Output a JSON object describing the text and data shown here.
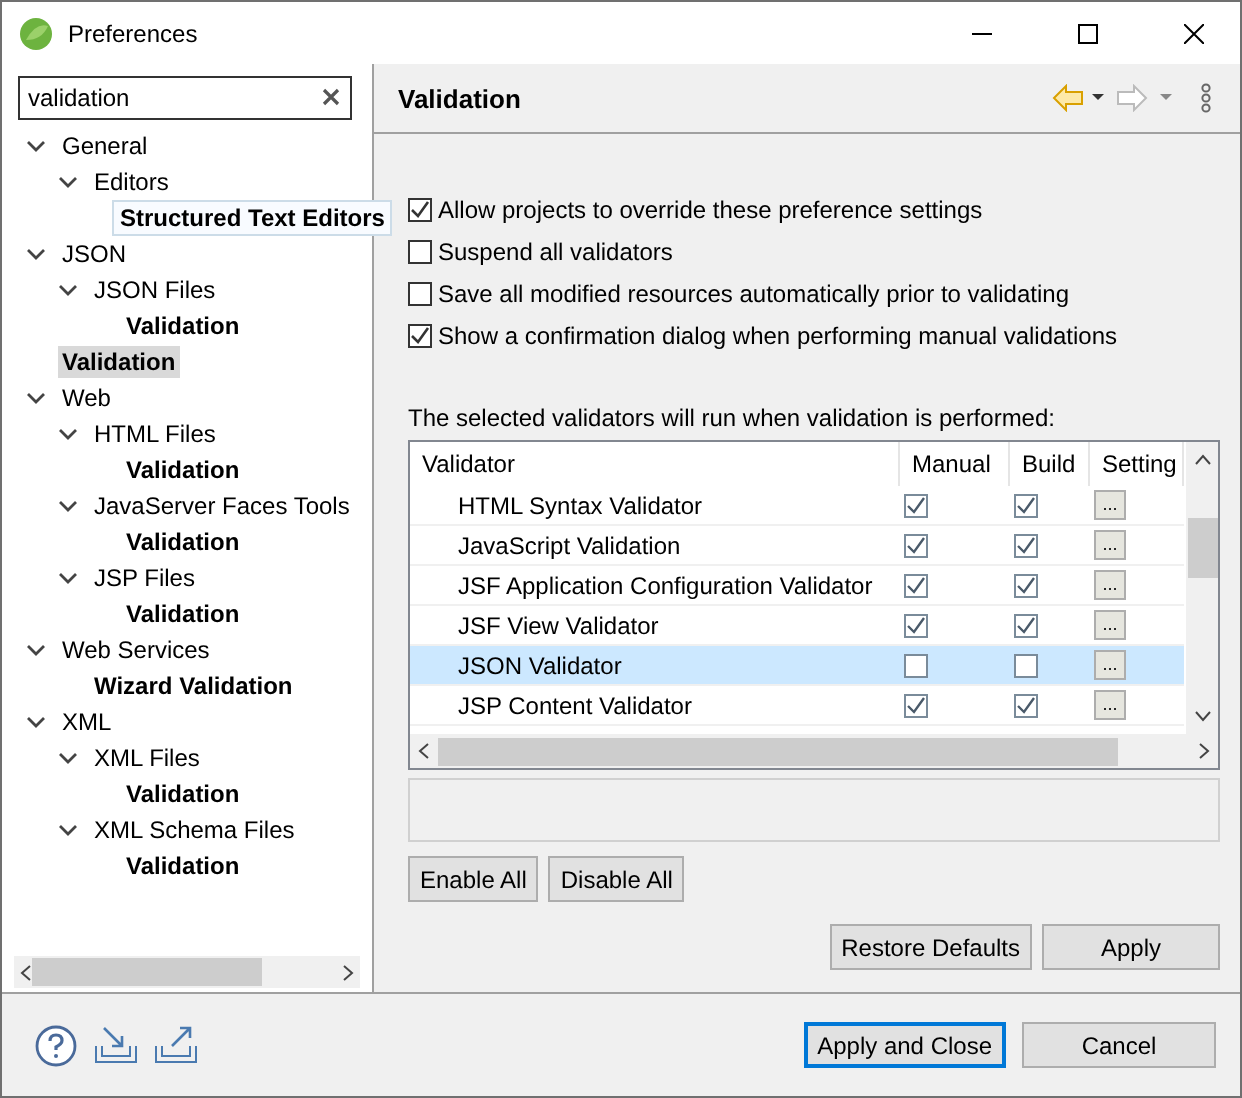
{
  "window": {
    "title": "Preferences"
  },
  "search": {
    "value": "validation"
  },
  "tree": [
    {
      "label": "General",
      "expanded": true,
      "children": [
        {
          "label": "Editors",
          "expanded": true,
          "children": [
            {
              "label": "Structured Text Editors",
              "kind": "tooltip"
            }
          ]
        }
      ]
    },
    {
      "label": "JSON",
      "expanded": true,
      "children": [
        {
          "label": "JSON Files",
          "expanded": true,
          "children": [
            {
              "label": "Validation"
            }
          ]
        }
      ]
    },
    {
      "label": "Validation",
      "selected": true
    },
    {
      "label": "Web",
      "expanded": true,
      "children": [
        {
          "label": "HTML Files",
          "expanded": true,
          "children": [
            {
              "label": "Validation"
            }
          ]
        },
        {
          "label": "JavaServer Faces Tools",
          "expanded": true,
          "children": [
            {
              "label": "Validation"
            }
          ]
        },
        {
          "label": "JSP Files",
          "expanded": true,
          "children": [
            {
              "label": "Validation"
            }
          ]
        }
      ]
    },
    {
      "label": "Web Services",
      "expanded": true,
      "children": [
        {
          "label": "Wizard Validation"
        }
      ]
    },
    {
      "label": "XML",
      "expanded": true,
      "children": [
        {
          "label": "XML Files",
          "expanded": true,
          "children": [
            {
              "label": "Validation"
            }
          ]
        },
        {
          "label": "XML Schema Files",
          "expanded": true,
          "children": [
            {
              "label": "Validation"
            }
          ]
        }
      ]
    }
  ],
  "page": {
    "title": "Validation"
  },
  "options": [
    {
      "label": "Allow projects to override these preference settings",
      "checked": true
    },
    {
      "label": "Suspend all validators",
      "checked": false
    },
    {
      "label": "Save all modified resources automatically prior to validating",
      "checked": false
    },
    {
      "label": "Show a confirmation dialog when performing manual validations",
      "checked": true
    }
  ],
  "table_caption": "The selected validators will run when validation is performed:",
  "table": {
    "columns": [
      "Validator",
      "Manual",
      "Build",
      "Setting"
    ],
    "rows": [
      {
        "name": "HTML Syntax Validator",
        "manual": true,
        "build": true,
        "settings": "...",
        "selected": false
      },
      {
        "name": "JavaScript Validation",
        "manual": true,
        "build": true,
        "settings": "...",
        "selected": false
      },
      {
        "name": "JSF Application Configuration Validator",
        "manual": true,
        "build": true,
        "settings": "...",
        "selected": false
      },
      {
        "name": "JSF View Validator",
        "manual": true,
        "build": true,
        "settings": "...",
        "selected": false
      },
      {
        "name": "JSON Validator",
        "manual": false,
        "build": false,
        "settings": "...",
        "selected": true
      },
      {
        "name": "JSP Content Validator",
        "manual": true,
        "build": true,
        "settings": "...",
        "selected": false
      }
    ]
  },
  "table_buttons": [
    "Enable All",
    "Disable All"
  ],
  "page_buttons": [
    "Restore Defaults",
    "Apply"
  ],
  "dialog_buttons": [
    {
      "label": "Apply and Close",
      "default": true
    },
    {
      "label": "Cancel",
      "default": false
    }
  ]
}
